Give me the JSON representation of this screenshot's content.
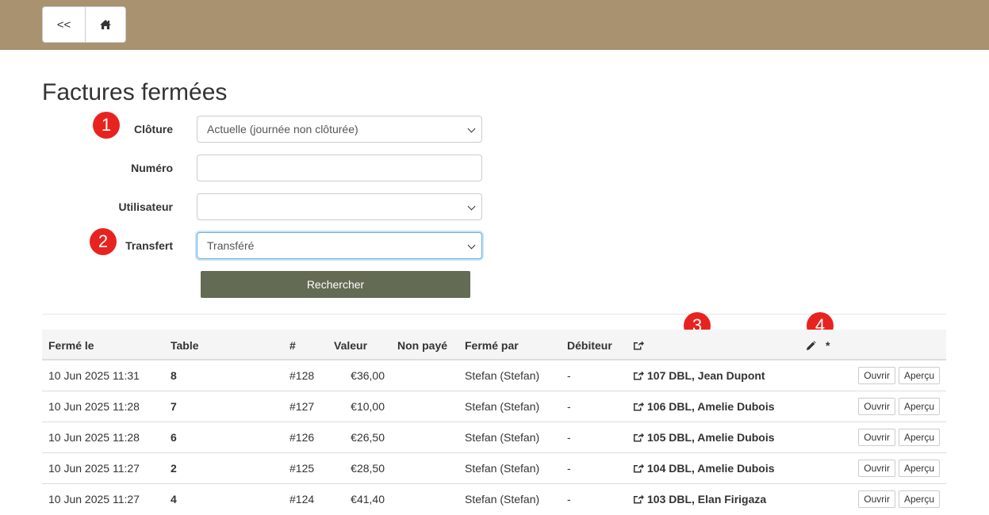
{
  "nav": {
    "back_label": "<<",
    "home_icon": "home-icon"
  },
  "page": {
    "title": "Factures fermées"
  },
  "form": {
    "cloture_label": "Clôture",
    "cloture_value": "Actuelle (journée non clôturée)",
    "numero_label": "Numéro",
    "numero_value": "",
    "utilisateur_label": "Utilisateur",
    "utilisateur_value": "",
    "transfert_label": "Transfert",
    "transfert_value": "Transféré",
    "search_label": "Rechercher"
  },
  "markers": [
    "1",
    "2",
    "3",
    "4"
  ],
  "table": {
    "headers": {
      "ferme_le": "Fermé le",
      "table": "Table",
      "number": "#",
      "valeur": "Valeur",
      "non_paye": "Non payé",
      "ferme_par": "Fermé par",
      "debiteur": "Débiteur",
      "transfer_icon": "share-icon",
      "edit_icon": "pencil-icon",
      "star": "*"
    },
    "rows": [
      {
        "date": "10 Jun 2025 11:31",
        "table": "8",
        "number": "#128",
        "valeur": "€36,00",
        "non_paye": "",
        "ferme_par": "Stefan (Stefan)",
        "debiteur": "-",
        "transfer": "107 DBL, Jean Dupont",
        "open": "Ouvrir",
        "preview": "Aperçu"
      },
      {
        "date": "10 Jun 2025 11:28",
        "table": "7",
        "number": "#127",
        "valeur": "€10,00",
        "non_paye": "",
        "ferme_par": "Stefan (Stefan)",
        "debiteur": "-",
        "transfer": "106 DBL, Amelie Dubois",
        "open": "Ouvrir",
        "preview": "Aperçu"
      },
      {
        "date": "10 Jun 2025 11:28",
        "table": "6",
        "number": "#126",
        "valeur": "€26,50",
        "non_paye": "",
        "ferme_par": "Stefan (Stefan)",
        "debiteur": "-",
        "transfer": "105 DBL, Amelie Dubois",
        "open": "Ouvrir",
        "preview": "Aperçu"
      },
      {
        "date": "10 Jun 2025 11:27",
        "table": "2",
        "number": "#125",
        "valeur": "€28,50",
        "non_paye": "",
        "ferme_par": "Stefan (Stefan)",
        "debiteur": "-",
        "transfer": "104 DBL, Amelie Dubois",
        "open": "Ouvrir",
        "preview": "Aperçu"
      },
      {
        "date": "10 Jun 2025 11:27",
        "table": "4",
        "number": "#124",
        "valeur": "€41,40",
        "non_paye": "",
        "ferme_par": "Stefan (Stefan)",
        "debiteur": "-",
        "transfer": "103 DBL, Elan Firigaza",
        "open": "Ouvrir",
        "preview": "Aperçu"
      }
    ]
  }
}
